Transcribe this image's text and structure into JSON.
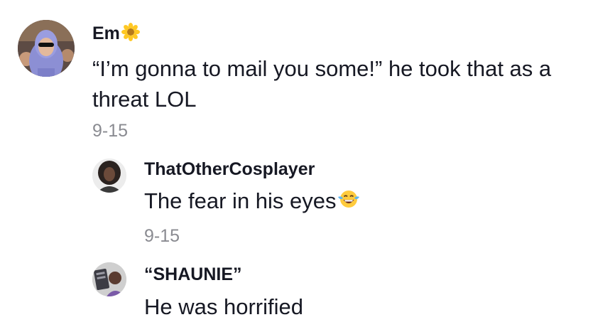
{
  "comments": [
    {
      "username": "Em",
      "username_emoji": "sunflower-icon",
      "text": "“I’m gonna to mail you some!” he took that as a threat LOL",
      "date": "9-15",
      "avatar": "avatar-hooded-figure-sunglasses"
    },
    {
      "username": "ThatOtherCosplayer",
      "text": "The fear in his eyes",
      "text_emoji": "tears-of-joy-icon",
      "date": "9-15",
      "avatar": "avatar-person-dark-hair"
    },
    {
      "username": "“SHAUNIE”",
      "text": "He was horrified",
      "avatar": "avatar-person-with-sign"
    }
  ],
  "colors": {
    "text": "#161823",
    "date": "#8a8b91",
    "background": "#ffffff"
  }
}
